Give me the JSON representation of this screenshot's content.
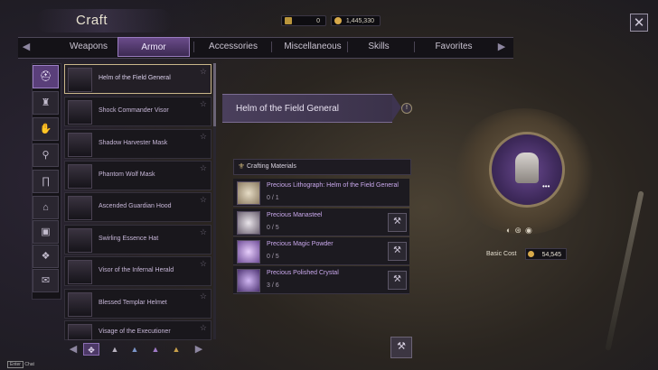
{
  "window": {
    "title": "Craft"
  },
  "currency": [
    {
      "icon": "arrow-token-icon",
      "value": "0"
    },
    {
      "icon": "gold-coin-icon",
      "value": "1,445,330"
    }
  ],
  "tabs": [
    {
      "label": "Weapons"
    },
    {
      "label": "Armor"
    },
    {
      "label": "Accessories"
    },
    {
      "label": "Miscellaneous"
    },
    {
      "label": "Skills"
    },
    {
      "label": "Favorites"
    }
  ],
  "active_tab": "Armor",
  "categories": [
    {
      "icon": "helmet-icon",
      "glyph": "⛑"
    },
    {
      "icon": "chest-armor-icon",
      "glyph": "♜"
    },
    {
      "icon": "gloves-icon",
      "glyph": "✋"
    },
    {
      "icon": "boots-icon",
      "glyph": "⚲"
    },
    {
      "icon": "pants-icon",
      "glyph": "∏"
    },
    {
      "icon": "shoe-icon",
      "glyph": "⌂"
    },
    {
      "icon": "chest-box-icon",
      "glyph": "▣"
    },
    {
      "icon": "pouch-icon",
      "glyph": "❖"
    },
    {
      "icon": "scroll-icon",
      "glyph": "✉"
    }
  ],
  "items": [
    {
      "name": "Helm of the Field General"
    },
    {
      "name": "Shock Commander Visor"
    },
    {
      "name": "Shadow Harvester Mask"
    },
    {
      "name": "Phantom Wolf Mask"
    },
    {
      "name": "Ascended Guardian Hood"
    },
    {
      "name": "Swirling Essence Hat"
    },
    {
      "name": "Visor of the Infernal Herald"
    },
    {
      "name": "Blessed Templar Helmet"
    },
    {
      "name": "Visage of the Executioner"
    }
  ],
  "filters": [
    {
      "icon": "all-filter-icon",
      "glyph": "✥"
    },
    {
      "icon": "grade-common-icon",
      "glyph": "▲"
    },
    {
      "icon": "grade-rare-icon",
      "glyph": "▲"
    },
    {
      "icon": "grade-epic-icon",
      "glyph": "▲"
    },
    {
      "icon": "grade-legendary-icon",
      "glyph": "▲"
    }
  ],
  "detail": {
    "title": "Helm of the Field General",
    "info_glyph": "!",
    "materials_header": "Crafting Materials",
    "materials": [
      {
        "name": "Precious Lithograph: Helm of the Field General",
        "qty": "0 / 1",
        "craftable": false
      },
      {
        "name": "Precious Manasteel",
        "qty": "0 / 5",
        "craftable": true
      },
      {
        "name": "Precious Magic Powder",
        "qty": "0 / 5",
        "craftable": true
      },
      {
        "name": "Precious Polished Crystal",
        "qty": "3 / 6",
        "craftable": true
      }
    ],
    "craft_glyph": "⚒",
    "basic_cost_label": "Basic Cost",
    "basic_cost_value": "54,545",
    "preview_dots": "•••",
    "ring_icons": "◐⊛◉"
  },
  "chat": {
    "key": "Enter",
    "label": "Chat"
  },
  "colors": {
    "accent": "#5a3f7a",
    "gold": "#d7a94a",
    "material_name": "#c9a8ec"
  }
}
